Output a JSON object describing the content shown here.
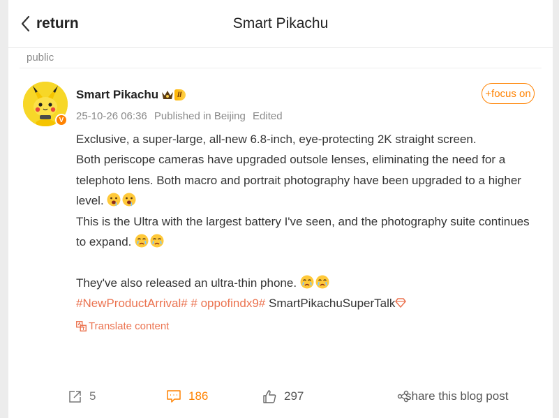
{
  "header": {
    "back_label": "return",
    "title": "Smart Pikachu"
  },
  "visibility": "public",
  "author": {
    "name": "Smart Pikachu",
    "level_badge": "II",
    "timestamp": "25-10-26 06:36",
    "location": "Published in Beijing",
    "edited": "Edited",
    "follow_label": "+focus on"
  },
  "post": {
    "line1": "Exclusive, a super-large, all-new 6.8-inch, eye-protecting 2K straight screen.",
    "line2": "Both periscope cameras have upgraded outsole lenses, eliminating the need for a telephoto lens. Both macro and portrait photography have been upgraded to a higher level.",
    "line3": "This is the Ultra with the largest battery I've seen, and the photography suite continues to expand.",
    "line4": "They've also released an ultra-thin phone.",
    "topic1": "#NewProductArrival#",
    "topic2": "# oppofindx9#",
    "supertalk": "SmartPikachuSuperTalk",
    "translate_label": "Translate content"
  },
  "actions": {
    "repost_count": "5",
    "comment_count": "186",
    "like_count": "297",
    "share_label": "share this blog post"
  },
  "colors": {
    "accent": "#ff8200",
    "topic": "#eb7350"
  }
}
